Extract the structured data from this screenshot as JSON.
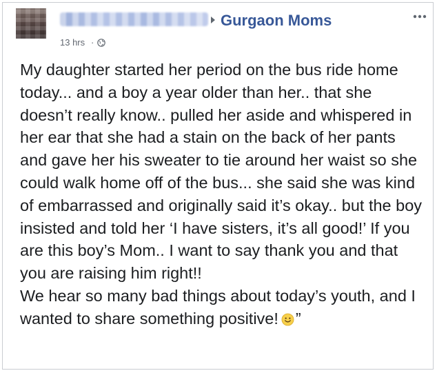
{
  "post": {
    "author_name": "",
    "group_name": "Gurgaon Moms",
    "timestamp": "13 hrs",
    "separator": "·",
    "privacy_icon": "globe-icon",
    "menu_icon": "more-options-icon",
    "paragraphs": [
      "My daughter started her period on the bus ride home today... and a boy a year older than her.. that she doesn’t really know.. pulled her aside and whispered in her ear that she had a stain on the back of her pants and gave her his sweater to tie around her waist so she could walk home off of the bus... she said she was kind of embarrassed and originally said it’s okay.. but the boy insisted and told her ‘I have sisters, it’s all good!’ If you are this boy’s Mom.. I want to say thank you and that you are raising him right!!",
      "We hear so many bad things about today’s youth, and I wanted to share something positive!"
    ],
    "trailing_emoji": "smiley-emoji-icon",
    "closing_quote": "”"
  },
  "colors": {
    "group_link": "#385898",
    "body_text": "#1c1e21",
    "meta_text": "#616770",
    "border": "#c9ccd1",
    "emoji": "#f7d04b"
  }
}
